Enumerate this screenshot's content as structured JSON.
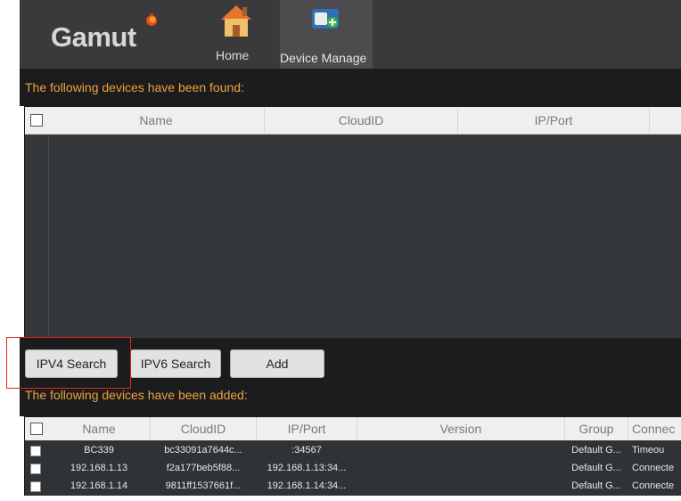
{
  "header": {
    "logo_text": "Gamut",
    "nav": [
      {
        "label": "Home",
        "icon": "home-icon"
      },
      {
        "label": "Device Manage",
        "icon": "device-add-icon"
      }
    ]
  },
  "found": {
    "title": "The following devices have been found:",
    "columns": [
      "Name",
      "CloudID",
      "IP/Port"
    ]
  },
  "buttons": {
    "ipv4": "IPV4 Search",
    "ipv6": "IPV6 Search",
    "add": "Add"
  },
  "added": {
    "title": "The following devices have been added:",
    "columns": [
      "Name",
      "CloudID",
      "IP/Port",
      "Version",
      "Group",
      "Connec"
    ],
    "rows": [
      {
        "name": "BC339",
        "cloudid": "bc33091a7644c...",
        "ipport": ":34567",
        "version": "",
        "group": "Default G...",
        "status": "Timeou"
      },
      {
        "name": "192.168.1.13",
        "cloudid": "f2a177beb5f88...",
        "ipport": "192.168.1.13:34...",
        "version": "",
        "group": "Default G...",
        "status": "Connecte"
      },
      {
        "name": "192.168.1.14",
        "cloudid": "9811ff1537661f...",
        "ipport": "192.168.1.14:34...",
        "version": "",
        "group": "Default G...",
        "status": "Connecte"
      }
    ]
  },
  "colors": {
    "accent_orange": "#f0a03a",
    "highlight_red": "#e8221c",
    "header_bg": "#3a3a3c"
  }
}
